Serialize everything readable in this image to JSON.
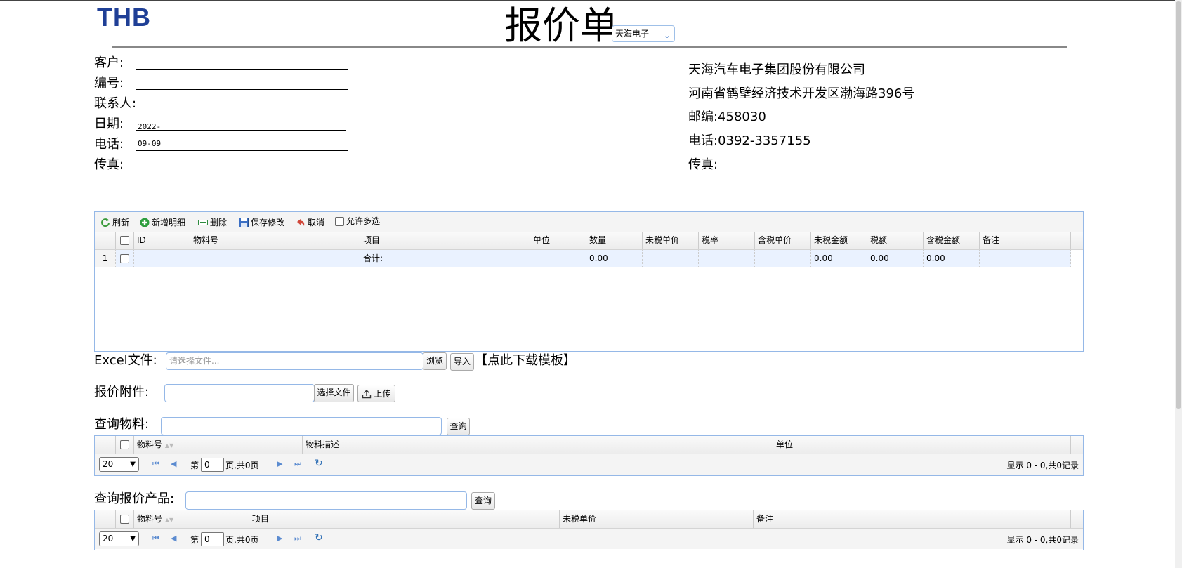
{
  "header": {
    "logo": "THB",
    "title": "报价单",
    "company_select": "天海电子"
  },
  "customer_fields": [
    {
      "label": "客户:",
      "value": ""
    },
    {
      "label": "编号:",
      "value": ""
    },
    {
      "label": "联系人:",
      "value": ""
    },
    {
      "label": "日期:",
      "value": "2022-09-09"
    },
    {
      "label": "电话:",
      "value": ""
    },
    {
      "label": "传真:",
      "value": ""
    }
  ],
  "company_info": {
    "name": "天海汽车电子集团股份有限公司",
    "address": "河南省鹤壁经济技术开发区渤海路396号",
    "postcode": "邮编:458030",
    "phone": "电话:0392-3357155",
    "fax": "传真:"
  },
  "detail_grid": {
    "toolbar": {
      "refresh": "刷新",
      "add": "新增明细",
      "delete": "删除",
      "save": "保存修改",
      "cancel": "取消",
      "multi_select": "允许多选"
    },
    "columns": [
      "ID",
      "物料号",
      "项目",
      "单位",
      "数量",
      "未税单价",
      "税率",
      "含税单价",
      "未税金额",
      "税额",
      "含税金额",
      "备注"
    ],
    "rows": [
      {
        "num": "1",
        "id": "",
        "material": "",
        "item": "合计:",
        "unit": "",
        "qty": "0.00",
        "price": "",
        "tax_rate": "",
        "tax_price": "",
        "amount": "0.00",
        "tax": "0.00",
        "tax_amount": "0.00",
        "remark": ""
      }
    ]
  },
  "excel": {
    "label": "Excel文件:",
    "placeholder": "请选择文件...",
    "browse": "浏览",
    "import": "导入",
    "template_link": "【点此下载模板】"
  },
  "attachment": {
    "label": "报价附件:",
    "choose": "选择文件",
    "upload": "上传"
  },
  "material_search": {
    "label": "查询物料:",
    "button": "查询",
    "columns": [
      "物料号",
      "物料描述",
      "单位"
    ],
    "pager": {
      "page_size": "20",
      "page_prefix": "第",
      "page": "0",
      "page_suffix": "页,共0页",
      "summary": "显示 0 - 0,共0记录"
    }
  },
  "product_search": {
    "label": "查询报价产品:",
    "button": "查询",
    "columns": [
      "物料号",
      "项目",
      "未税单价",
      "备注"
    ],
    "pager": {
      "page_size": "20",
      "page_prefix": "第",
      "page": "0",
      "page_suffix": "页,共0页",
      "summary": "显示 0 - 0,共0记录"
    }
  }
}
